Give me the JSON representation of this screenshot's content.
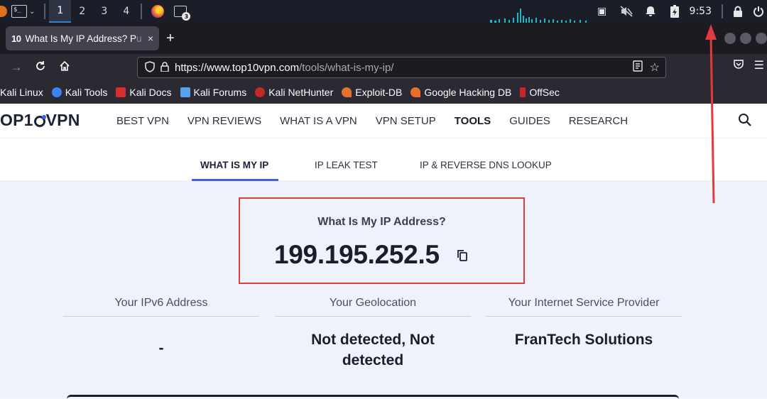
{
  "system_panel": {
    "workspaces": [
      "1",
      "2",
      "3",
      "4"
    ],
    "active_workspace": 0,
    "terminal_badge": "3",
    "terminal_icon_text": "$_",
    "clock": "9:53",
    "tray_icons": [
      "window-icon",
      "mute-icon",
      "bell-icon",
      "battery-icon"
    ]
  },
  "browser": {
    "tab": {
      "favicon_text": "10",
      "title_visible": "What Is My IP Address? P",
      "title_faded": "u",
      "close_label": "×"
    },
    "new_tab_label": "+",
    "url": {
      "host": "https://www.top10vpn.com",
      "path": "/tools/what-is-my-ip/"
    },
    "bookmarks": [
      {
        "label": "Kali Linux",
        "color": "#2b2a33"
      },
      {
        "label": "Kali Tools",
        "color": "#3b82f6"
      },
      {
        "label": "Kali Docs",
        "color": "#d32f2f"
      },
      {
        "label": "Kali Forums",
        "color": "#3b82f6"
      },
      {
        "label": "Kali NetHunter",
        "color": "#d32f2f"
      },
      {
        "label": "Exploit-DB",
        "color": "#e8702a"
      },
      {
        "label": "Google Hacking DB",
        "color": "#e8702a"
      },
      {
        "label": "OffSec",
        "color": "#d32f2f"
      }
    ]
  },
  "site": {
    "logo": {
      "before": "OP1",
      "after": "VPN"
    },
    "menu": [
      "BEST VPN",
      "VPN REVIEWS",
      "WHAT IS A VPN",
      "VPN SETUP",
      "TOOLS",
      "GUIDES",
      "RESEARCH"
    ],
    "active_menu": "TOOLS",
    "subnav": [
      "WHAT IS MY IP",
      "IP LEAK TEST",
      "IP & REVERSE DNS LOOKUP"
    ],
    "ip_question": "What Is My IP Address?",
    "ip_value": "199.195.252.5",
    "columns": [
      {
        "label": "Your IPv6 Address",
        "value": "-"
      },
      {
        "label": "Your Geolocation",
        "value": "Not detected, Not detected"
      },
      {
        "label": "Your Internet Service Provider",
        "value": "FranTech Solutions"
      }
    ]
  },
  "colors": {
    "highlight_box": "#e23b3b",
    "annotation_arrow": "#e23b3b",
    "accent": "#4a5fd6"
  }
}
